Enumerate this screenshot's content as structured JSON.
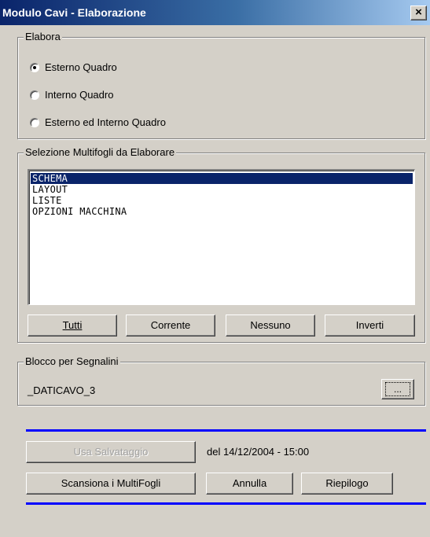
{
  "window": {
    "title": "Modulo Cavi - Elaborazione",
    "close_glyph": "×"
  },
  "elabora": {
    "legend": "Elabora",
    "options": [
      {
        "label": "Esterno Quadro",
        "checked": true
      },
      {
        "label": "Interno Quadro",
        "checked": false
      },
      {
        "label": "Esterno ed Interno Quadro",
        "checked": false
      }
    ]
  },
  "selezione": {
    "legend": "Selezione Multifogli da Elaborare",
    "items": [
      "SCHEMA",
      "LAYOUT",
      "LISTE",
      "OPZIONI MACCHINA"
    ],
    "selected_index": 0,
    "buttons": {
      "tutti": "Tutti",
      "corrente": "Corrente",
      "nessuno": "Nessuno",
      "inverti": "Inverti"
    }
  },
  "blocco": {
    "legend": "Blocco per Segnalini",
    "value": "_DATICAVO_3",
    "browse_label": "..."
  },
  "footer": {
    "usa_salvataggio": "Usa Salvataggio",
    "salvataggio_date": "del 14/12/2004 - 15:00",
    "scansiona": "Scansiona i MultiFogli",
    "annulla": "Annulla",
    "riepilogo": "Riepilogo"
  },
  "colors": {
    "title_bar_start": "#0a246a",
    "title_bar_end": "#a6caf0",
    "selection": "#0a246a",
    "separator_line": "#0000ff",
    "face": "#d4d0c8"
  }
}
